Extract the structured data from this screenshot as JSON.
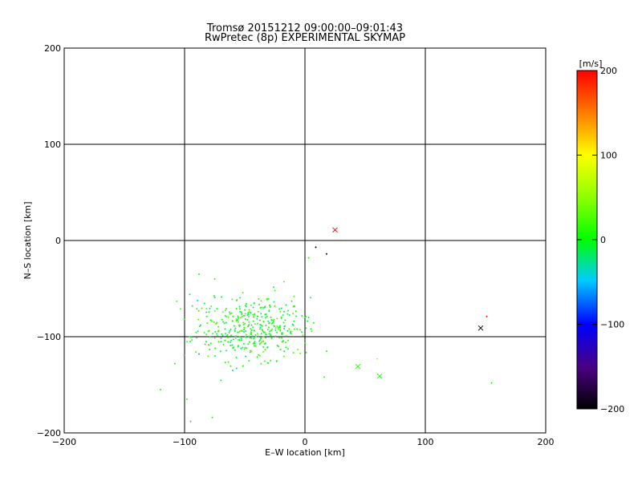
{
  "chart_data": {
    "type": "scatter",
    "title": "Tromsø 20151212 09:00:00–09:01:43",
    "subtitle": "RwPretec (8p) EXPERIMENTAL SKYMAP",
    "xlabel": "E–W location [km]",
    "ylabel": "N–S location [km]",
    "xlim": [
      -200,
      200
    ],
    "ylim": [
      -200,
      200
    ],
    "xticks": [
      -200,
      -100,
      0,
      100,
      200
    ],
    "yticks": [
      -200,
      -100,
      0,
      100,
      200
    ],
    "xtick_labels": [
      "−200",
      "−100",
      "0",
      "100",
      "200"
    ],
    "ytick_labels": [
      "−200",
      "−100",
      "0",
      "100",
      "200"
    ],
    "grid": true,
    "colorbar": {
      "label": "[m/s]",
      "range": [
        -200,
        200
      ],
      "ticks": [
        200,
        100,
        0,
        -100,
        -200
      ],
      "tick_labels": [
        "200",
        "100",
        "0",
        "−100",
        "−200"
      ]
    },
    "cluster": {
      "center": [
        -45,
        -92
      ],
      "spread": [
        24,
        16
      ],
      "count": 420,
      "velocity_range": [
        -25,
        30
      ]
    },
    "points": [
      {
        "x": 25,
        "y": 11,
        "v": 200,
        "marker": "x"
      },
      {
        "x": 9,
        "y": -7,
        "v": -200,
        "marker": "dot"
      },
      {
        "x": 18,
        "y": -14,
        "v": -200,
        "marker": "dot"
      },
      {
        "x": 3,
        "y": -18,
        "v": 10,
        "marker": "dot"
      },
      {
        "x": 146,
        "y": -91,
        "v": -200,
        "marker": "x"
      },
      {
        "x": 151,
        "y": -79,
        "v": 200,
        "marker": "dot"
      },
      {
        "x": 155,
        "y": -148,
        "v": 0,
        "marker": "dot"
      },
      {
        "x": 44,
        "y": -131,
        "v": 10,
        "marker": "x"
      },
      {
        "x": 62,
        "y": -141,
        "v": 10,
        "marker": "x"
      },
      {
        "x": 60,
        "y": -123,
        "v": 70,
        "marker": "dot"
      },
      {
        "x": -95,
        "y": -188,
        "v": 0,
        "marker": "dot"
      },
      {
        "x": -77,
        "y": -184,
        "v": 10,
        "marker": "dot"
      },
      {
        "x": -120,
        "y": -155,
        "v": 5,
        "marker": "dot"
      },
      {
        "x": -108,
        "y": -128,
        "v": 10,
        "marker": "dot"
      },
      {
        "x": -88,
        "y": -35,
        "v": 10,
        "marker": "dot"
      },
      {
        "x": -75,
        "y": -40,
        "v": 15,
        "marker": "dot"
      },
      {
        "x": -25,
        "y": -52,
        "v": 20,
        "marker": "dot"
      },
      {
        "x": 5,
        "y": -92,
        "v": 0,
        "marker": "dot"
      },
      {
        "x": 18,
        "y": -115,
        "v": 10,
        "marker": "dot"
      },
      {
        "x": 16,
        "y": -142,
        "v": 15,
        "marker": "dot"
      },
      {
        "x": 3,
        "y": -80,
        "v": 5,
        "marker": "dot"
      },
      {
        "x": -88,
        "y": -118,
        "v": -60,
        "marker": "dot"
      },
      {
        "x": -98,
        "y": -165,
        "v": 20,
        "marker": "dot"
      },
      {
        "x": -60,
        "y": -135,
        "v": -40,
        "marker": "dot"
      }
    ]
  }
}
